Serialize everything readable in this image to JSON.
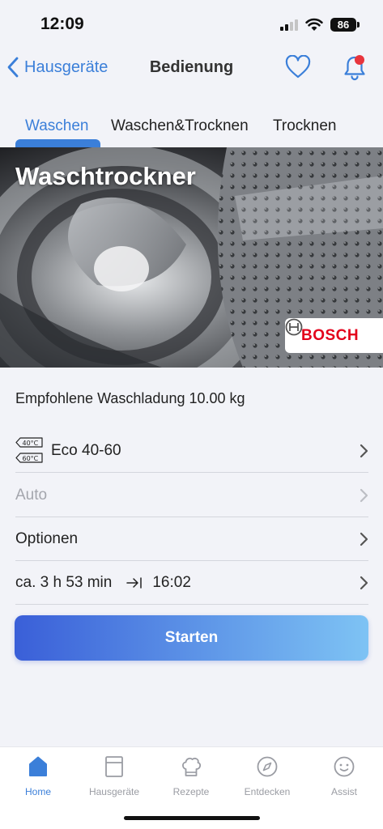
{
  "status": {
    "time": "12:09",
    "battery": "86"
  },
  "nav": {
    "back_label": "Hausgeräte",
    "title": "Bedienung"
  },
  "tabs": [
    {
      "label": "Waschen",
      "active": true
    },
    {
      "label": "Waschen&Trocknen",
      "active": false
    },
    {
      "label": "Trocknen",
      "active": false
    }
  ],
  "hero": {
    "title": "Waschtrockner",
    "brand": "BOSCH"
  },
  "recommendation": "Empfohlene Waschladung 10.00 kg",
  "program": {
    "temp_top": "40°C",
    "temp_bottom": "60°C",
    "label": "Eco 40-60"
  },
  "mode": {
    "label": "Auto"
  },
  "options": {
    "label": "Optionen"
  },
  "duration": {
    "label": "ca. 3 h 53 min",
    "end_time": "16:02"
  },
  "start_button": "Starten",
  "tabbar": [
    {
      "label": "Home",
      "icon": "home-icon",
      "active": true
    },
    {
      "label": "Hausgeräte",
      "icon": "appliance-icon",
      "active": false
    },
    {
      "label": "Rezepte",
      "icon": "chef-hat-icon",
      "active": false
    },
    {
      "label": "Entdecken",
      "icon": "compass-icon",
      "active": false
    },
    {
      "label": "Assist",
      "icon": "assistant-face-icon",
      "active": false
    }
  ],
  "colors": {
    "accent": "#3b7fd9",
    "notification": "#e8343c",
    "brand": "#e3001b",
    "background": "#f2f3f8"
  }
}
